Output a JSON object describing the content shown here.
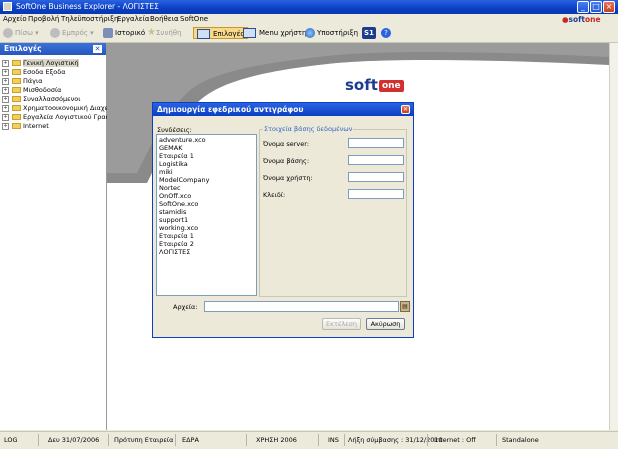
{
  "window": {
    "title": "SoftOne Business Explorer - ΛΟΓΙΣΤΕΣ"
  },
  "menu": [
    "Αρχείο",
    "Προβολή",
    "Τηλεϋποστήριξη",
    "Εργαλεία",
    "Βοήθεια",
    "SoftOne"
  ],
  "brand": {
    "small_logo": "soft",
    "small_logo_accent": "one",
    "logo": "soft",
    "logo_accent": "one"
  },
  "toolbar": {
    "back": "Πίσω",
    "forward": "Εμπρός",
    "history": "Ιστορικό",
    "favorites": "Συνήθη",
    "options": "Επιλογές",
    "user_menu": "Menu χρήστη",
    "support": "Υποστήριξη",
    "s1": "S1"
  },
  "left_panel": {
    "title": "Επιλογές",
    "items": [
      "Γενική Λογιστική",
      "Εσοδα Εξοδα",
      "Πάγια",
      "Μισθοδοσία",
      "Συναλλασσόμενοι",
      "Χρηματοοικονομική Διαχεί",
      "Εργαλεία Λογιστικού Γραφ",
      "Internet"
    ]
  },
  "dialog": {
    "title": "Δημιουργία εφεδρικού αντιγράφου",
    "connections_label": "Συνδέσεις:",
    "connections": [
      "adventure.xco",
      "GEMAK",
      "Εταιρεία 1",
      "Logistika",
      "miki",
      "ModelCompany",
      "Nortec",
      "OnOff.xco",
      "SoftOne.xco",
      "stamidis",
      "support1",
      "working.xco",
      "Εταιρεία 1",
      "Εταιρεία 2",
      "ΛΟΓΙΣΤΕΣ"
    ],
    "db_group_label": "Στοιχεία βάσης δεδομένων",
    "server_label": "Όνομα server:",
    "db_name_label": "Όνομα βάσης:",
    "user_label": "Όνομα χρήστη:",
    "password_label": "Κλειδί:",
    "server_value": "",
    "db_name_value": "",
    "user_value": "",
    "password_value": "",
    "files_label": "Αρχεία:",
    "files_value": "",
    "execute_button": "Εκτέλεση",
    "cancel_button": "Ακύρωση"
  },
  "status_bar": {
    "log": "LOG",
    "date": "Δευ 31/07/2006",
    "company": "Πρότυπη Εταιρεία",
    "branch": "ΕΔΡΑ",
    "year": "ΧΡΗΣΗ 2006",
    "ins": "INS",
    "contract": "Λήξη σύμβασης : 31/12/2010",
    "internet": "Internet : Off",
    "mode": "Standalone"
  },
  "colors": {
    "titlebar": "#0a3fc4",
    "brand_red": "#d32f2f",
    "brand_blue": "#1d3c8f",
    "active_tab": "#f9d98a"
  }
}
